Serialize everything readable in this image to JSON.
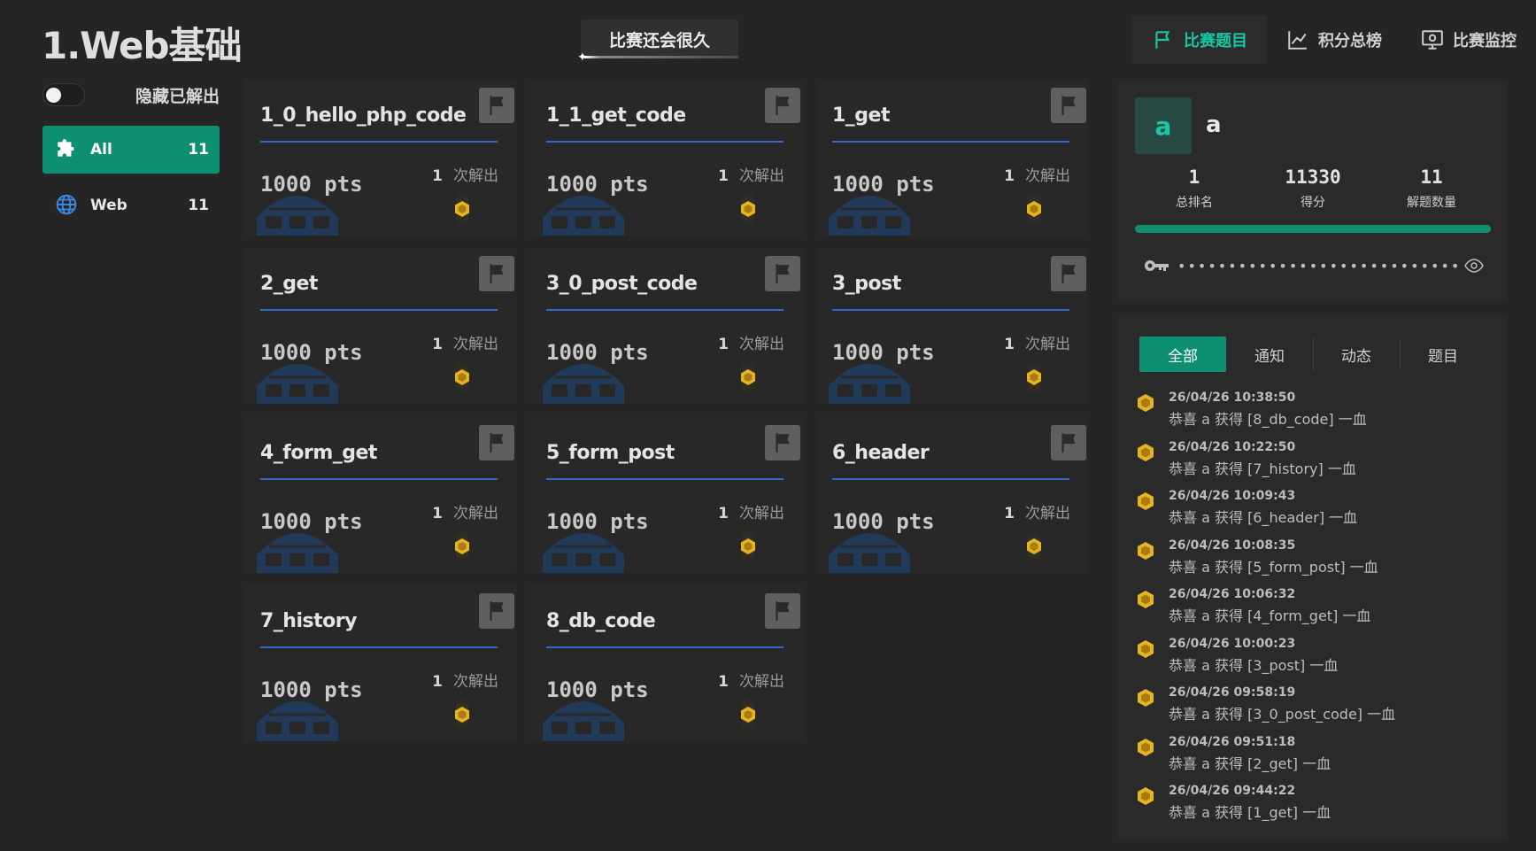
{
  "header": {
    "title": "1.Web基础",
    "countdown": "比赛还会很久",
    "nav": [
      {
        "label": "比赛题目",
        "icon": "flag-icon",
        "active": true
      },
      {
        "label": "积分总榜",
        "icon": "chart-line-icon",
        "active": false
      },
      {
        "label": "比赛监控",
        "icon": "monitor-icon",
        "active": false
      }
    ]
  },
  "sidebar": {
    "hide_solved_label": "隐藏已解出",
    "hide_solved_on": false,
    "categories": [
      {
        "label": "All",
        "count": "11",
        "icon": "puzzle-icon",
        "active": true
      },
      {
        "label": "Web",
        "count": "11",
        "icon": "globe-icon",
        "active": false
      }
    ]
  },
  "challenges": [
    {
      "name": "1_0_hello_php_code",
      "points": "1000 pts",
      "solves": "1",
      "solves_label": "次解出"
    },
    {
      "name": "1_1_get_code",
      "points": "1000 pts",
      "solves": "1",
      "solves_label": "次解出"
    },
    {
      "name": "1_get",
      "points": "1000 pts",
      "solves": "1",
      "solves_label": "次解出"
    },
    {
      "name": "2_get",
      "points": "1000 pts",
      "solves": "1",
      "solves_label": "次解出"
    },
    {
      "name": "3_0_post_code",
      "points": "1000 pts",
      "solves": "1",
      "solves_label": "次解出"
    },
    {
      "name": "3_post",
      "points": "1000 pts",
      "solves": "1",
      "solves_label": "次解出"
    },
    {
      "name": "4_form_get",
      "points": "1000 pts",
      "solves": "1",
      "solves_label": "次解出"
    },
    {
      "name": "5_form_post",
      "points": "1000 pts",
      "solves": "1",
      "solves_label": "次解出"
    },
    {
      "name": "6_header",
      "points": "1000 pts",
      "solves": "1",
      "solves_label": "次解出"
    },
    {
      "name": "7_history",
      "points": "1000 pts",
      "solves": "1",
      "solves_label": "次解出"
    },
    {
      "name": "8_db_code",
      "points": "1000 pts",
      "solves": "1",
      "solves_label": "次解出"
    }
  ],
  "user": {
    "avatar_letter": "a",
    "name": "a",
    "rank": "1",
    "rank_label": "总排名",
    "score": "11330",
    "score_label": "得分",
    "solved": "11",
    "solved_label": "解题数量",
    "progress_fraction": 1.0,
    "token_masked": "••••••••••••••••••••••••••••••••"
  },
  "feed": {
    "tabs": [
      {
        "label": "全部",
        "active": true
      },
      {
        "label": "通知",
        "active": false
      },
      {
        "label": "动态",
        "active": false
      },
      {
        "label": "题目",
        "active": false
      }
    ],
    "items": [
      {
        "time": "26/04/26 10:38:50",
        "message": "恭喜 a 获得 [8_db_code] 一血"
      },
      {
        "time": "26/04/26 10:22:50",
        "message": "恭喜 a 获得 [7_history] 一血"
      },
      {
        "time": "26/04/26 10:09:43",
        "message": "恭喜 a 获得 [6_header] 一血"
      },
      {
        "time": "26/04/26 10:08:35",
        "message": "恭喜 a 获得 [5_form_post] 一血"
      },
      {
        "time": "26/04/26 10:06:32",
        "message": "恭喜 a 获得 [4_form_get] 一血"
      },
      {
        "time": "26/04/26 10:00:23",
        "message": "恭喜 a 获得 [3_post] 一血"
      },
      {
        "time": "26/04/26 09:58:19",
        "message": "恭喜 a 获得 [3_0_post_code] 一血"
      },
      {
        "time": "26/04/26 09:51:18",
        "message": "恭喜 a 获得 [2_get] 一血"
      },
      {
        "time": "26/04/26 09:44:22",
        "message": "恭喜 a 获得 [1_get] 一血"
      }
    ]
  },
  "colors": {
    "accent": "#0f8f72",
    "accent_text": "#17c7a4",
    "divider_blue": "#2e6bc9",
    "blood_gold": "#e6b422"
  }
}
